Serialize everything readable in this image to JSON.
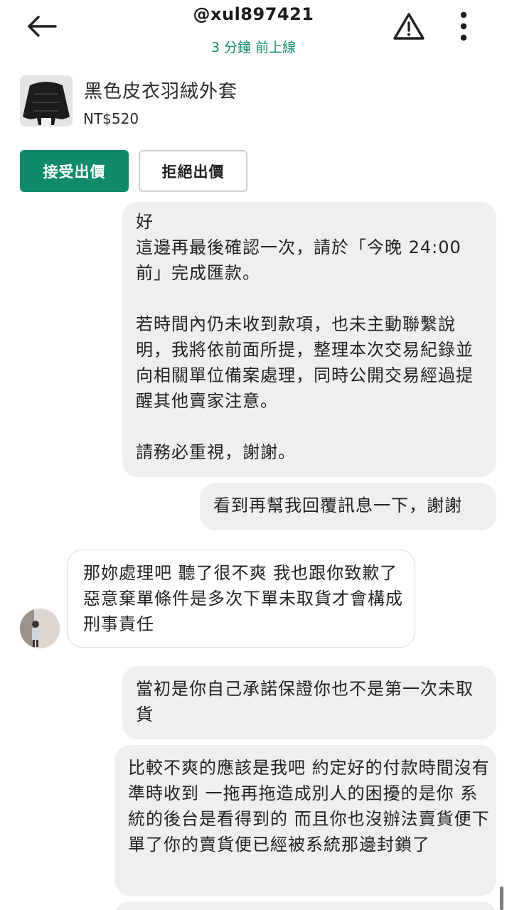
{
  "header": {
    "username": "@xul897421",
    "status": "3 分鐘 前上線"
  },
  "listing": {
    "title": "黑色皮衣羽絨外套",
    "price": "NT$520"
  },
  "actions": {
    "accept_label": "接受出價",
    "reject_label": "拒絕出價"
  },
  "messages": [
    {
      "from": "me",
      "text": "好\n這邊再最後確認一次，請於「今晚 24:00 前」完成匯款。\n\n若時間內仍未收到款項，也未主動聯繫說明，我將依前面所提，整理本次交易紀錄並向相關單位備案處理，同時公開交易經過提醒其他賣家注意。\n\n請務必重視，謝謝。"
    },
    {
      "from": "me",
      "text": "看到再幫我回覆訊息一下，謝謝"
    },
    {
      "from": "other",
      "text": "那妳處理吧 聽了很不爽 我也跟你致歉了 惡意棄單條件是多次下單未取貨才會構成刑事責任"
    },
    {
      "from": "me",
      "text": "當初是你自己承諾保證你也不是第一次未取貨"
    },
    {
      "from": "me",
      "text": "比較不爽的應該是我吧 約定好的付款時間沒有準時收到 一拖再拖造成別人的困擾的是你 系統的後台是看得到的 而且你也沒辦法賣貨便下單了你的賣貨便已經被系統那邊封鎖了"
    }
  ],
  "icons": {
    "back": "arrow-left-icon",
    "report": "warning-triangle-icon",
    "more": "more-vertical-icon"
  },
  "colors": {
    "accent": "#0f8a6b",
    "sent_bubble": "#efefef",
    "received_bubble": "#ffffff"
  }
}
